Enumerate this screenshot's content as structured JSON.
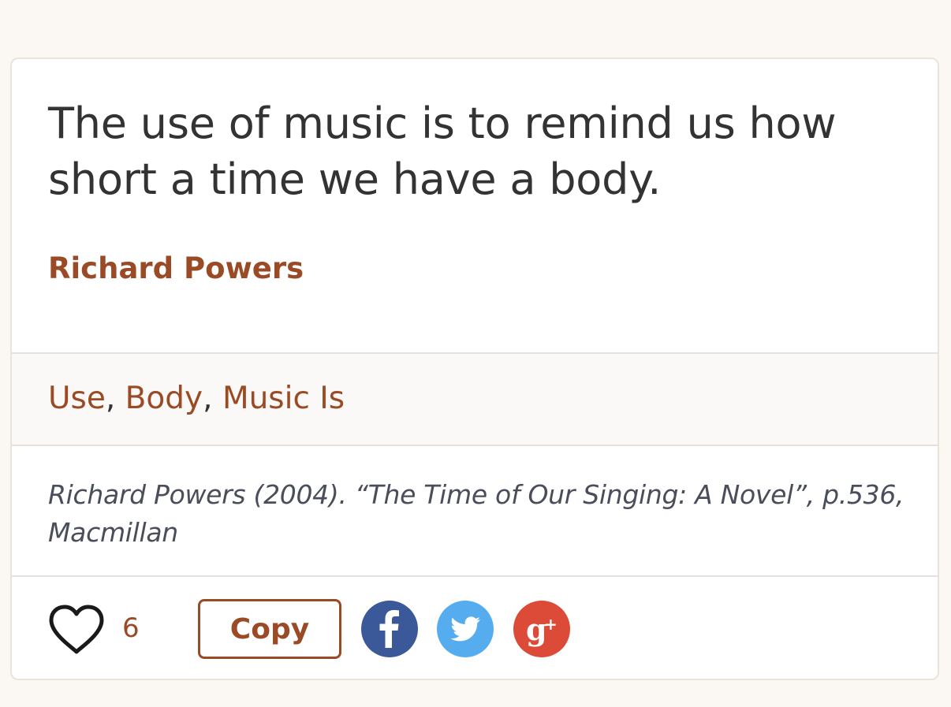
{
  "quote": {
    "text": "The use of music is to remind us how short a time we have a body.",
    "author": "Richard Powers"
  },
  "tags": [
    {
      "label": "Use"
    },
    {
      "label": "Body"
    },
    {
      "label": "Music Is"
    }
  ],
  "tag_separator": ",",
  "source": {
    "text": "Richard Powers (2004). “The Time of Our Singing: A Novel”, p.536, Macmillan"
  },
  "actions": {
    "like_count": "6",
    "copy_label": "Copy",
    "icons": {
      "like": "heart-icon",
      "facebook": "facebook-icon",
      "twitter": "twitter-icon",
      "google_plus": "google-plus-icon"
    }
  },
  "colors": {
    "accent": "#9a4b25",
    "facebook": "#3b5998",
    "twitter": "#55acee",
    "google_plus": "#dc4a38",
    "page_bg": "#fbf7f2"
  }
}
